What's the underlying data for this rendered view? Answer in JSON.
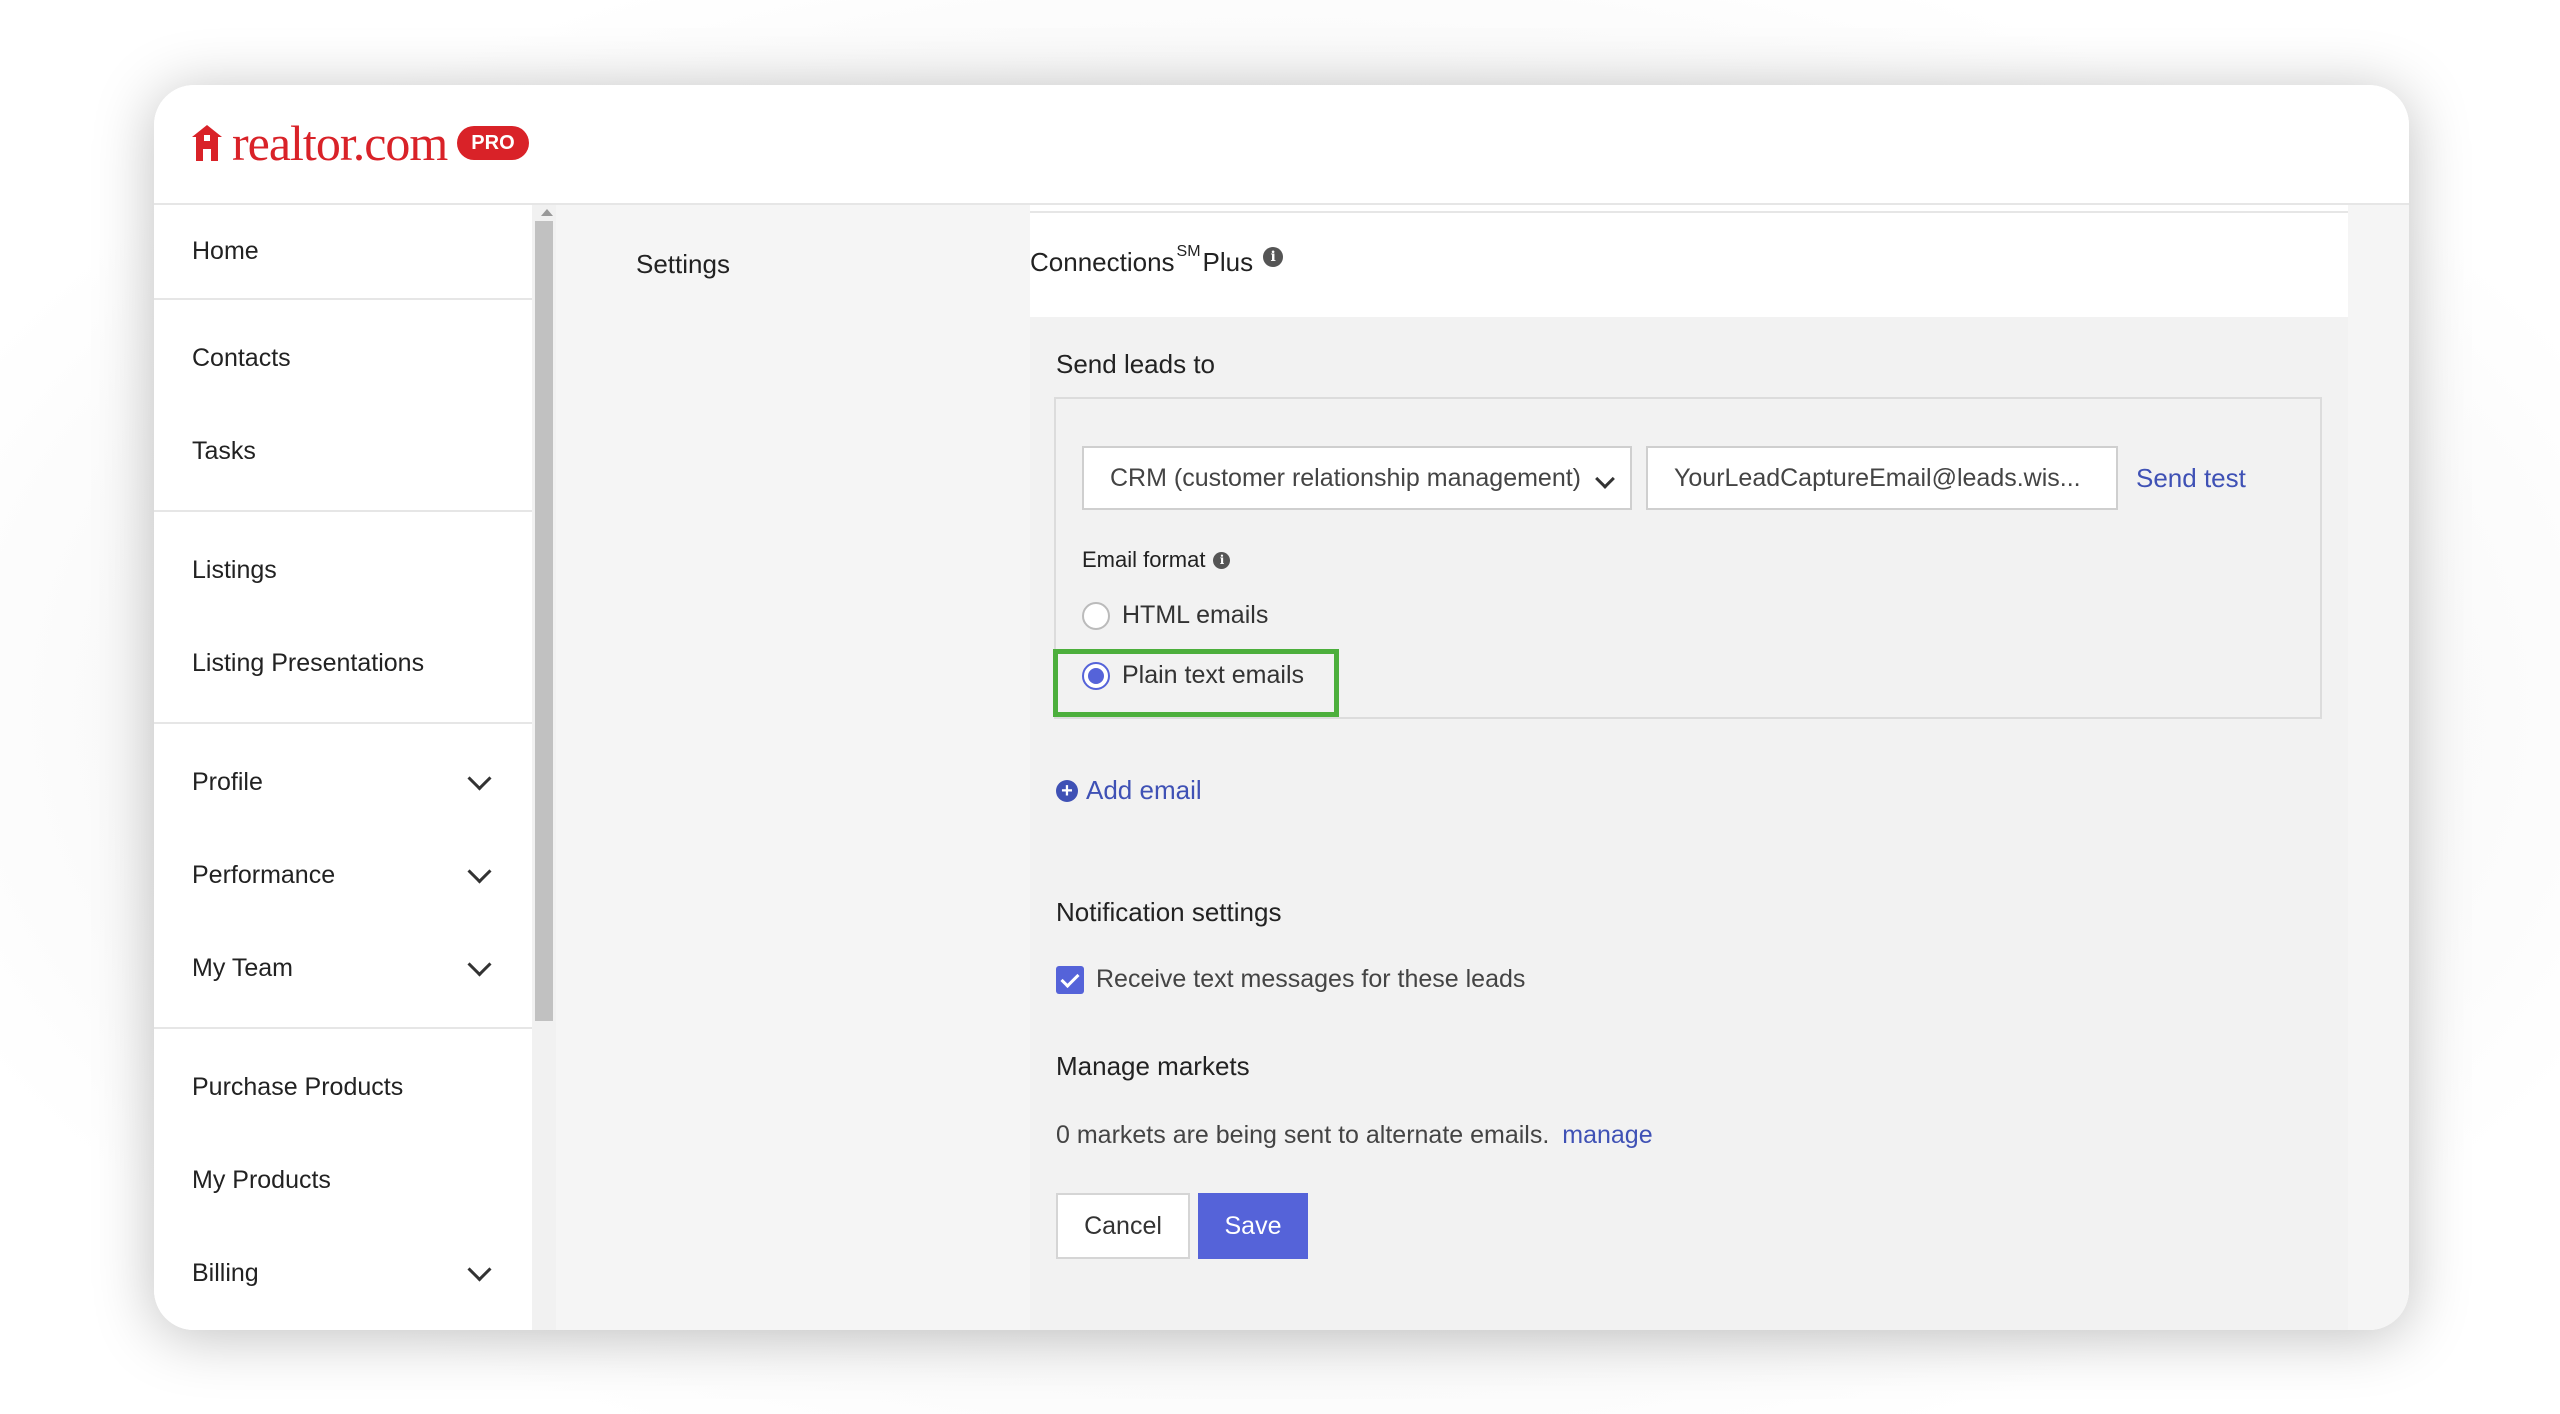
{
  "brand": {
    "name": "realtor.com",
    "badge": "PRO",
    "color": "#d92228"
  },
  "sidebar": {
    "groups": [
      [
        {
          "label": "Home",
          "has_chevron": false
        }
      ],
      [
        {
          "label": "Contacts",
          "has_chevron": false
        },
        {
          "label": "Tasks",
          "has_chevron": false
        }
      ],
      [
        {
          "label": "Listings",
          "has_chevron": false
        },
        {
          "label": "Listing Presentations",
          "has_chevron": false
        }
      ],
      [
        {
          "label": "Profile",
          "has_chevron": true
        },
        {
          "label": "Performance",
          "has_chevron": true
        },
        {
          "label": "My Team",
          "has_chevron": true
        }
      ],
      [
        {
          "label": "Purchase Products",
          "has_chevron": false
        },
        {
          "label": "My Products",
          "has_chevron": false
        },
        {
          "label": "Billing",
          "has_chevron": true
        }
      ]
    ]
  },
  "settings": {
    "label": "Settings"
  },
  "connections": {
    "title": "Connections",
    "superscript": "SM",
    "title_suffix": "Plus",
    "info_icon": "info-icon"
  },
  "leads": {
    "send_leads_label": "Send leads to",
    "destination_select": "CRM (customer relationship management)",
    "email_value": "YourLeadCaptureEmail@leads.wis...",
    "send_test_label": "Send test",
    "email_format_label": "Email format",
    "format_options": [
      {
        "label": "HTML emails",
        "checked": false
      },
      {
        "label": "Plain text emails",
        "checked": true
      }
    ],
    "add_email_label": "Add email"
  },
  "notifications": {
    "title": "Notification settings",
    "sms_label": "Receive text messages for these leads",
    "sms_checked": true
  },
  "markets": {
    "title": "Manage markets",
    "text": "0 markets are being sent to alternate emails.",
    "link": "manage"
  },
  "actions": {
    "cancel": "Cancel",
    "save": "Save"
  },
  "colors": {
    "accent": "#5563d9",
    "link": "#3f51b5",
    "highlight": "#4caf3c"
  }
}
